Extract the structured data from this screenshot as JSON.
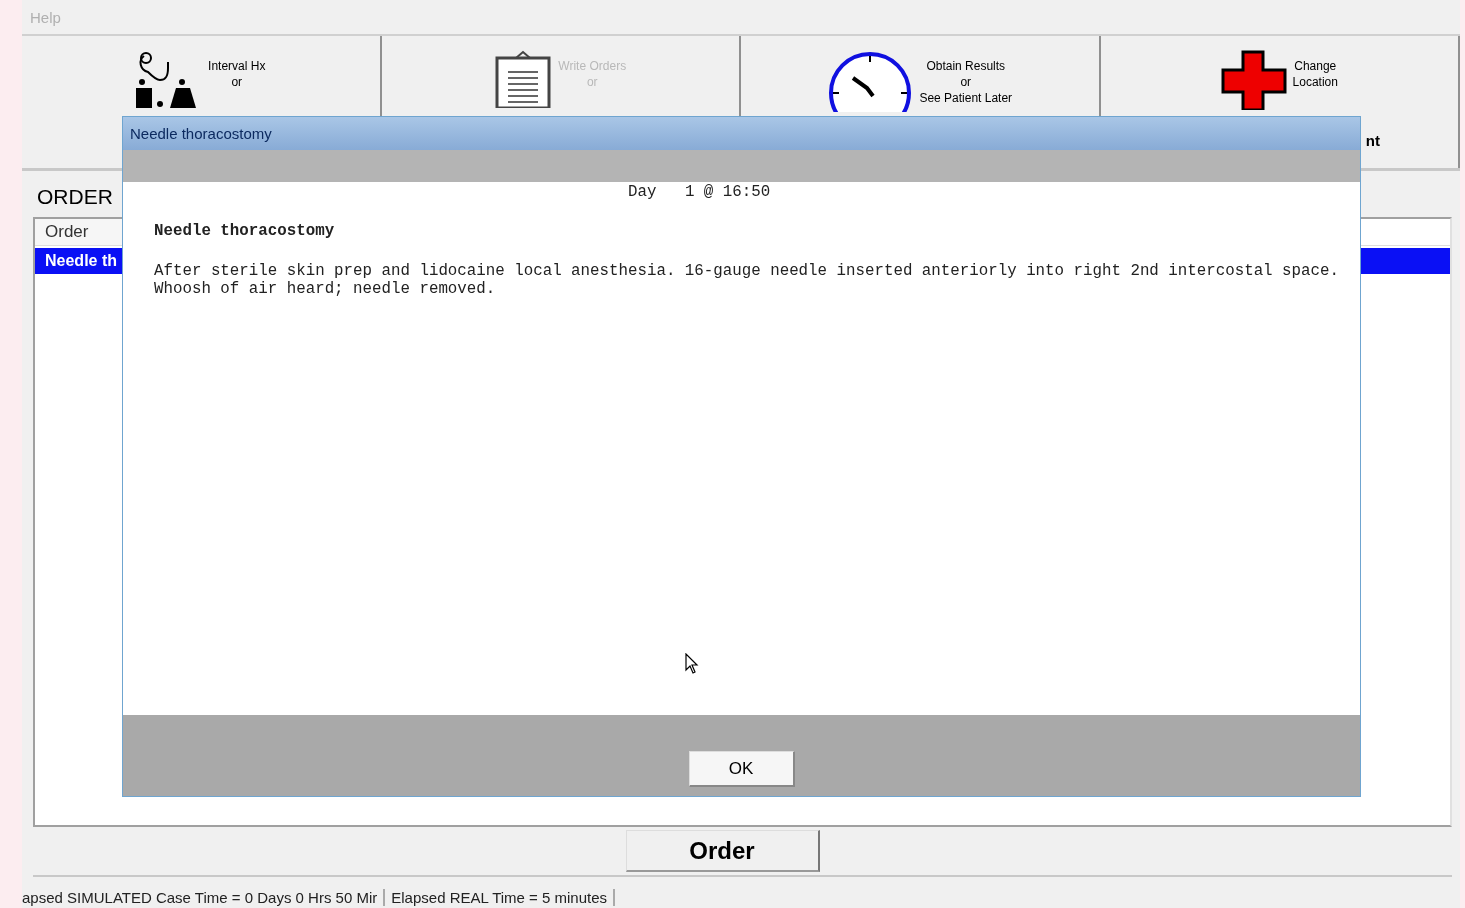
{
  "menu_bar": {
    "items": [
      {
        "label": "Help",
        "disabled": true
      }
    ]
  },
  "toolbar": {
    "buttons": [
      {
        "kind": "history",
        "lines": [
          "Interval Hx",
          "or"
        ],
        "disabled": false
      },
      {
        "kind": "orders",
        "lines": [
          "Write Orders",
          "or"
        ],
        "disabled": true
      },
      {
        "kind": "results",
        "lines": [
          "Obtain Results",
          "or",
          "See Patient Later"
        ],
        "disabled": false
      },
      {
        "kind": "location",
        "lines": [
          "Change",
          "Location"
        ],
        "trailing": "nt",
        "disabled": false
      }
    ]
  },
  "order_panel": {
    "title": "ORDER",
    "columns": [
      "Order"
    ],
    "rows": [
      {
        "cells": [
          "Needle th"
        ],
        "selected": true
      }
    ],
    "button": "Order"
  },
  "status_bar": [
    "apsed SIMULATED Case Time = 0 Days 0 Hrs 50 Mir",
    "Elapsed REAL Time = 5 minutes"
  ],
  "dialog": {
    "title": "Needle thoracostomy",
    "timestamp": "Day   1 @ 16:50",
    "heading": "Needle thoracostomy",
    "body": "After sterile skin prep and lidocaine local anesthesia. 16-gauge needle inserted anteriorly into right 2nd intercostal space.  Whoosh of air heard; needle removed.",
    "button": "OK"
  }
}
